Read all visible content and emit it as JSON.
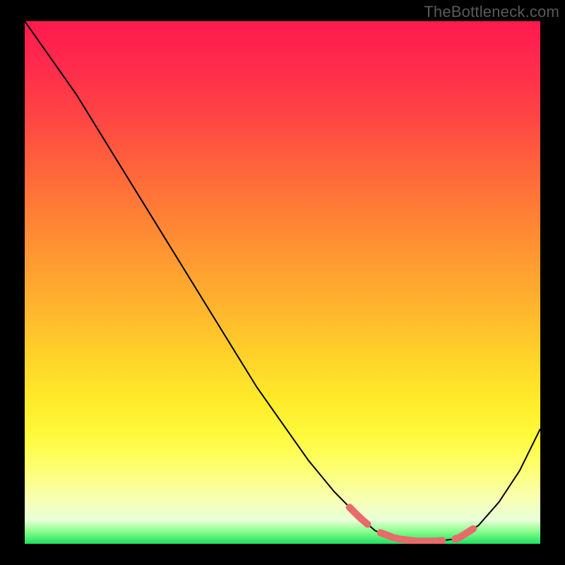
{
  "watermark": "TheBottleneck.com",
  "chart_data": {
    "type": "line",
    "title": "",
    "xlabel": "",
    "ylabel": "",
    "x": [
      0.0,
      0.05,
      0.1,
      0.15,
      0.2,
      0.25,
      0.3,
      0.35,
      0.4,
      0.45,
      0.5,
      0.55,
      0.6,
      0.65,
      0.68,
      0.72,
      0.76,
      0.8,
      0.84,
      0.88,
      0.92,
      0.96,
      1.0
    ],
    "values": [
      1.0,
      0.93,
      0.86,
      0.78,
      0.7,
      0.62,
      0.54,
      0.46,
      0.38,
      0.3,
      0.23,
      0.16,
      0.1,
      0.05,
      0.025,
      0.01,
      0.005,
      0.005,
      0.01,
      0.035,
      0.08,
      0.14,
      0.22
    ],
    "optimal_band": {
      "x_start": 0.63,
      "x_end": 0.87
    },
    "xlim": [
      0,
      1
    ],
    "ylim": [
      0,
      1
    ],
    "grid": false,
    "legend": false,
    "background_gradient": {
      "top_color": "#ff1a4d",
      "bottom_color": "#20e060"
    }
  }
}
